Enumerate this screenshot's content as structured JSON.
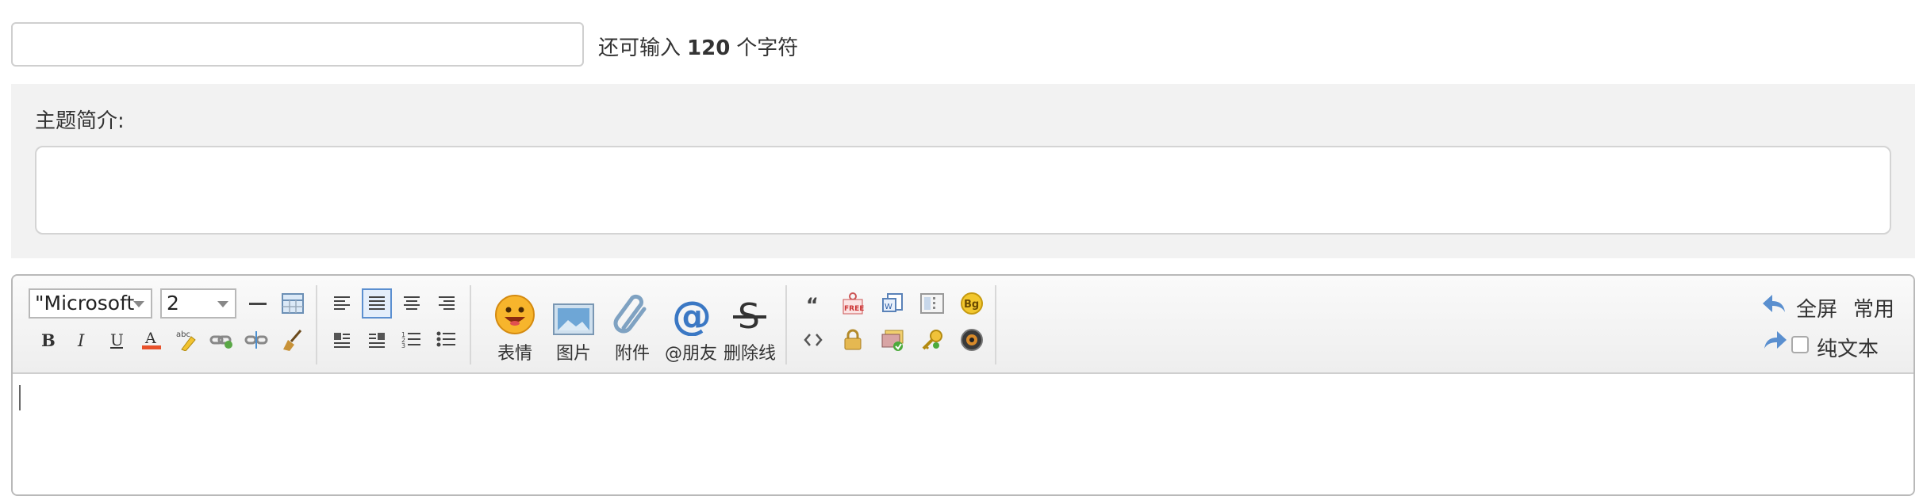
{
  "title_field": {
    "value": "",
    "placeholder": ""
  },
  "char_hint": {
    "prefix": "还可输入",
    "count": "120",
    "suffix": "个字符"
  },
  "summary": {
    "label": "主题简介:",
    "value": ""
  },
  "editor": {
    "font_select": {
      "value": "\"Microsoft"
    },
    "size_select": {
      "value": "2"
    },
    "big_buttons": [
      {
        "label": "表情",
        "icon": "smiley-icon"
      },
      {
        "label": "图片",
        "icon": "image-icon"
      },
      {
        "label": "附件",
        "icon": "paperclip-icon"
      },
      {
        "label": "@朋友",
        "icon": "at-icon"
      },
      {
        "label": "删除线",
        "icon": "strikethrough-icon"
      }
    ],
    "right": {
      "fullscreen": "全屏",
      "common": "常用",
      "plain_text": "纯文本"
    },
    "content": ""
  },
  "colors": {
    "active_border": "#5b8fd0",
    "panel_bg": "#f2f2f2"
  }
}
